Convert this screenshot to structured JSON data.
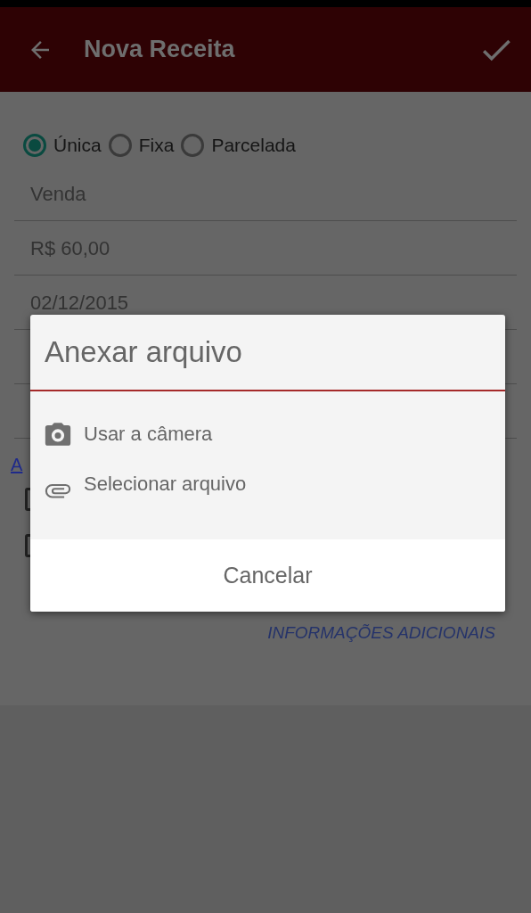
{
  "app_bar": {
    "title": "Nova Receita"
  },
  "type_options": [
    {
      "label": "Única",
      "selected": true
    },
    {
      "label": "Fixa",
      "selected": false
    },
    {
      "label": "Parcelada",
      "selected": false
    }
  ],
  "fields": [
    {
      "value": "Venda"
    },
    {
      "value": "R$ 60,00"
    },
    {
      "value": "02/12/2015"
    }
  ],
  "link": "A",
  "checkboxes": [
    {
      "checked": false
    },
    {
      "checked": false
    }
  ],
  "more_link": "INFORMAÇÕES ADICIONAIS",
  "dialog": {
    "title": "Anexar arquivo",
    "options": [
      {
        "kind": "camera",
        "label": "Usar a câmera"
      },
      {
        "kind": "attach",
        "label": "Selecionar arquivo"
      }
    ],
    "cancel": "Cancelar"
  }
}
